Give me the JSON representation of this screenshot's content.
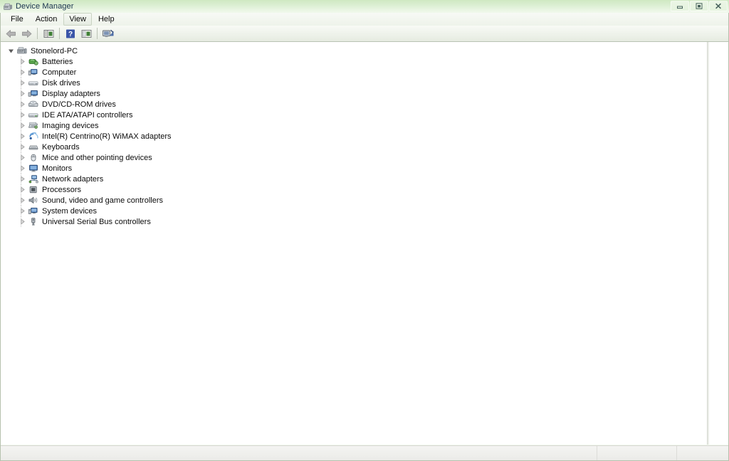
{
  "window": {
    "title": "Device Manager",
    "title_icon": "device-manager-icon",
    "buttons": {
      "minimize": "minimize-icon",
      "maximize": "restore-icon",
      "close": "close-icon"
    }
  },
  "menubar": {
    "items": [
      {
        "label": "File",
        "state": "normal"
      },
      {
        "label": "Action",
        "state": "normal"
      },
      {
        "label": "View",
        "state": "hover"
      },
      {
        "label": "Help",
        "state": "normal"
      }
    ]
  },
  "toolbar": {
    "buttons": [
      {
        "name": "back-button",
        "icon": "back-arrow-icon",
        "enabled": false
      },
      {
        "name": "forward-button",
        "icon": "forward-arrow-icon",
        "enabled": false
      },
      {
        "name": "show-hide-console-tree-button",
        "icon": "console-tree-icon",
        "enabled": true
      },
      {
        "name": "help-button",
        "icon": "help-question-icon",
        "enabled": true
      },
      {
        "name": "properties-button",
        "icon": "properties-icon",
        "enabled": true
      },
      {
        "name": "scan-hardware-changes-button",
        "icon": "scan-hardware-icon",
        "enabled": true
      }
    ]
  },
  "tree": {
    "root": {
      "label": "Stonelord-PC",
      "icon": "computer-root-icon",
      "expanded": true
    },
    "nodes": [
      {
        "label": "Batteries",
        "icon": "battery-icon",
        "expanded": false
      },
      {
        "label": "Computer",
        "icon": "computer-icon",
        "expanded": false
      },
      {
        "label": "Disk drives",
        "icon": "disk-drive-icon",
        "expanded": false
      },
      {
        "label": "Display adapters",
        "icon": "display-adapter-icon",
        "expanded": false
      },
      {
        "label": "DVD/CD-ROM drives",
        "icon": "dvd-drive-icon",
        "expanded": false
      },
      {
        "label": "IDE ATA/ATAPI controllers",
        "icon": "ide-controller-icon",
        "expanded": false
      },
      {
        "label": "Imaging devices",
        "icon": "imaging-device-icon",
        "expanded": false
      },
      {
        "label": "Intel(R) Centrino(R) WiMAX adapters",
        "icon": "wireless-adapter-icon",
        "expanded": false
      },
      {
        "label": "Keyboards",
        "icon": "keyboard-icon",
        "expanded": false
      },
      {
        "label": "Mice and other pointing devices",
        "icon": "mouse-icon",
        "expanded": false
      },
      {
        "label": "Monitors",
        "icon": "monitor-icon",
        "expanded": false
      },
      {
        "label": "Network adapters",
        "icon": "network-adapter-icon",
        "expanded": false
      },
      {
        "label": "Processors",
        "icon": "processor-icon",
        "expanded": false
      },
      {
        "label": "Sound, video and game controllers",
        "icon": "sound-controller-icon",
        "expanded": false
      },
      {
        "label": "System devices",
        "icon": "system-device-icon",
        "expanded": false
      },
      {
        "label": "Universal Serial Bus controllers",
        "icon": "usb-controller-icon",
        "expanded": false
      }
    ]
  },
  "statusbar": {
    "cells": [
      "",
      "",
      ""
    ]
  },
  "colors": {
    "titlebar_gradient_top": "#cfe8c2",
    "titlebar_gradient_bottom": "#f0f8ec",
    "title_text": "#19334d",
    "content_background": "#ffffff",
    "text": "#0c0c0c",
    "frame_border": "#b6c2ae",
    "statusbar_background": "#efefec"
  }
}
